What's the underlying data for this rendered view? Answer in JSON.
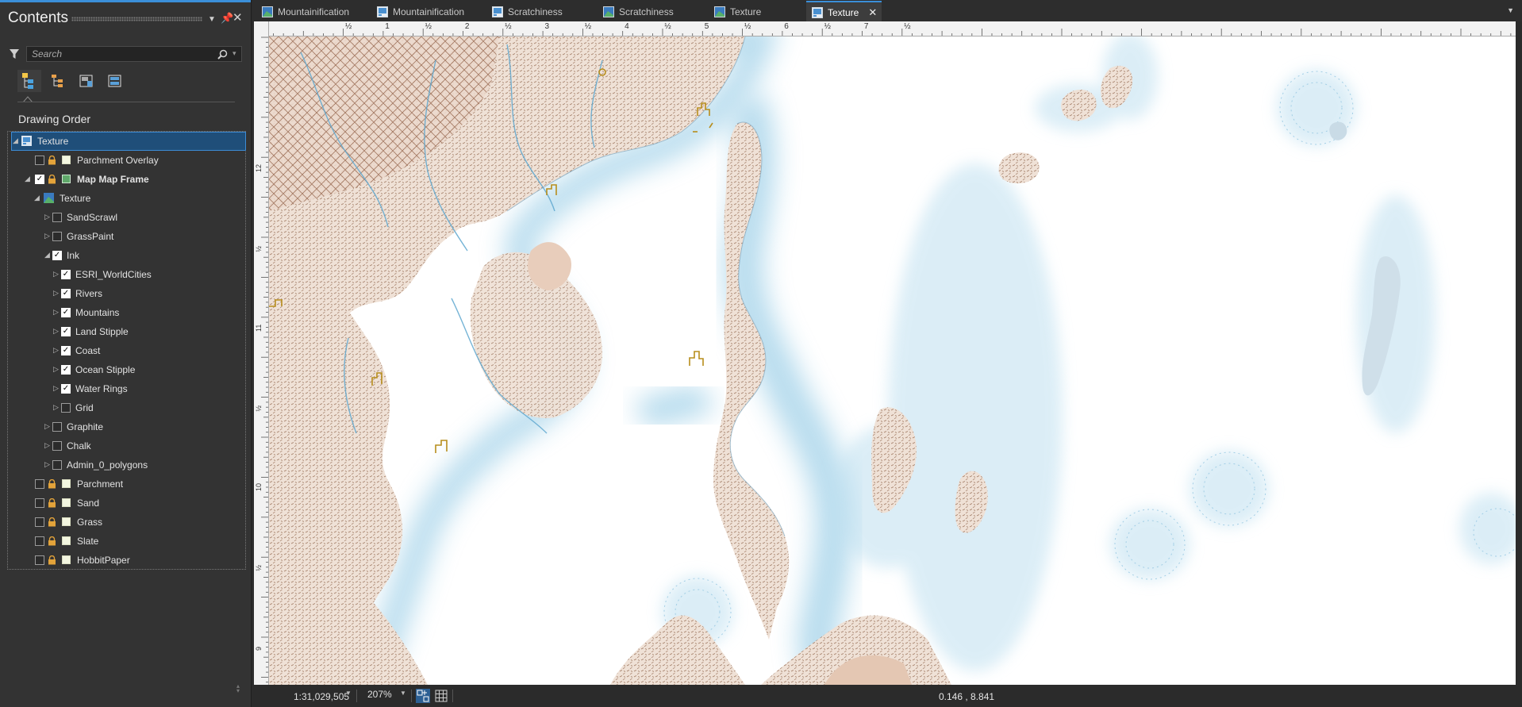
{
  "pane": {
    "title": "Contents",
    "search_placeholder": "Search",
    "section_label": "Drawing Order"
  },
  "tree": [
    {
      "label": "Texture",
      "kind": "map",
      "selected": true
    },
    {
      "label": "Parchment Overlay",
      "checked": false,
      "locked": true
    },
    {
      "label": "Map Map Frame",
      "checked": true,
      "bold": true
    },
    {
      "label": "Texture",
      "kind": "group"
    },
    {
      "label": "SandScrawl",
      "checked": false
    },
    {
      "label": "GrassPaint",
      "checked": false
    },
    {
      "label": "Ink",
      "checked": true
    },
    {
      "label": "ESRI_WorldCities",
      "checked": true
    },
    {
      "label": "Rivers",
      "checked": true
    },
    {
      "label": "Mountains",
      "checked": true
    },
    {
      "label": "Land Stipple",
      "checked": true
    },
    {
      "label": "Coast",
      "checked": true
    },
    {
      "label": "Ocean Stipple",
      "checked": true
    },
    {
      "label": "Water Rings",
      "checked": true
    },
    {
      "label": "Grid",
      "checked": false
    },
    {
      "label": "Graphite",
      "checked": false
    },
    {
      "label": "Chalk",
      "checked": false
    },
    {
      "label": "Admin_0_polygons",
      "checked": false
    },
    {
      "label": "Parchment",
      "checked": false,
      "locked": true
    },
    {
      "label": "Sand",
      "checked": false,
      "locked": true
    },
    {
      "label": "Grass",
      "checked": false,
      "locked": true
    },
    {
      "label": "Slate",
      "checked": false,
      "locked": true
    },
    {
      "label": "HobbitPaper",
      "checked": false,
      "locked": true
    }
  ],
  "tabs": [
    {
      "label": "Mountainification",
      "icon": "map-icon"
    },
    {
      "label": "Mountainification",
      "icon": "layout-icon"
    },
    {
      "label": "Scratchiness",
      "icon": "layout-icon"
    },
    {
      "label": "Scratchiness",
      "icon": "map-icon"
    },
    {
      "label": "Texture",
      "icon": "map-icon"
    },
    {
      "label": "Texture",
      "icon": "layout-icon",
      "active": true
    }
  ],
  "ruler": {
    "h_labels": [
      "½",
      "1",
      "½",
      "2",
      "½",
      "3",
      "½",
      "4",
      "½",
      "5",
      "½",
      "6",
      "½",
      "7",
      "½"
    ],
    "v_labels": [
      "12",
      "½",
      "11",
      "½",
      "10",
      "½",
      "9"
    ]
  },
  "status": {
    "scale": "1:31,029,505",
    "zoom": "207%",
    "coordinates": "0.146 , 8.841"
  },
  "colors": {
    "accent": "#3b8fd9",
    "land": "#c9a48c",
    "water_ink": "#6fb3d6"
  }
}
